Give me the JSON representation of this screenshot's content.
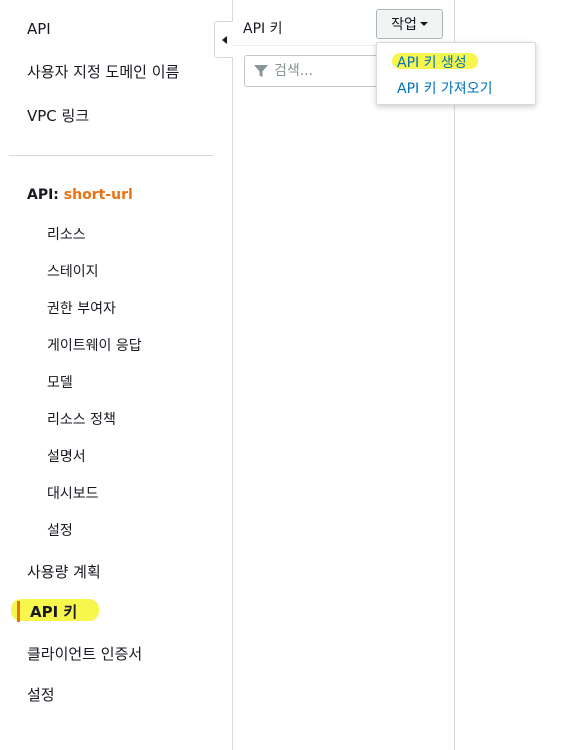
{
  "sidebar": {
    "top_items": [
      {
        "label": "API"
      },
      {
        "label": "사용자 지정 도메인 이름"
      },
      {
        "label": "VPC 링크"
      }
    ],
    "api_section": {
      "prefix": "API:",
      "name": "short-url",
      "name_color": "#ec7211",
      "sub_items": [
        {
          "label": "리소스"
        },
        {
          "label": "스테이지"
        },
        {
          "label": "권한 부여자"
        },
        {
          "label": "게이트웨이 응답"
        },
        {
          "label": "모델"
        },
        {
          "label": "리소스 정책"
        },
        {
          "label": "설명서"
        },
        {
          "label": "대시보드"
        },
        {
          "label": "설정"
        }
      ]
    },
    "bottom_items": [
      {
        "label": "사용량 계획"
      },
      {
        "label": "API 키",
        "active": true
      },
      {
        "label": "클라이언트 인증서"
      },
      {
        "label": "설정"
      }
    ],
    "collapse_icon": "caret-left-icon"
  },
  "panel": {
    "title": "API 키",
    "actions_label": "작업",
    "search_placeholder": "검색...",
    "search_value": "",
    "filter_icon": "filter-icon"
  },
  "dropdown": {
    "items": [
      {
        "label": "API 키 생성",
        "highlighted": true
      },
      {
        "label": "API 키 가져오기"
      }
    ]
  },
  "colors": {
    "accent": "#ec7211",
    "link": "#0073bb",
    "highlight": "#f5f53a",
    "border": "#d5dbdb"
  }
}
